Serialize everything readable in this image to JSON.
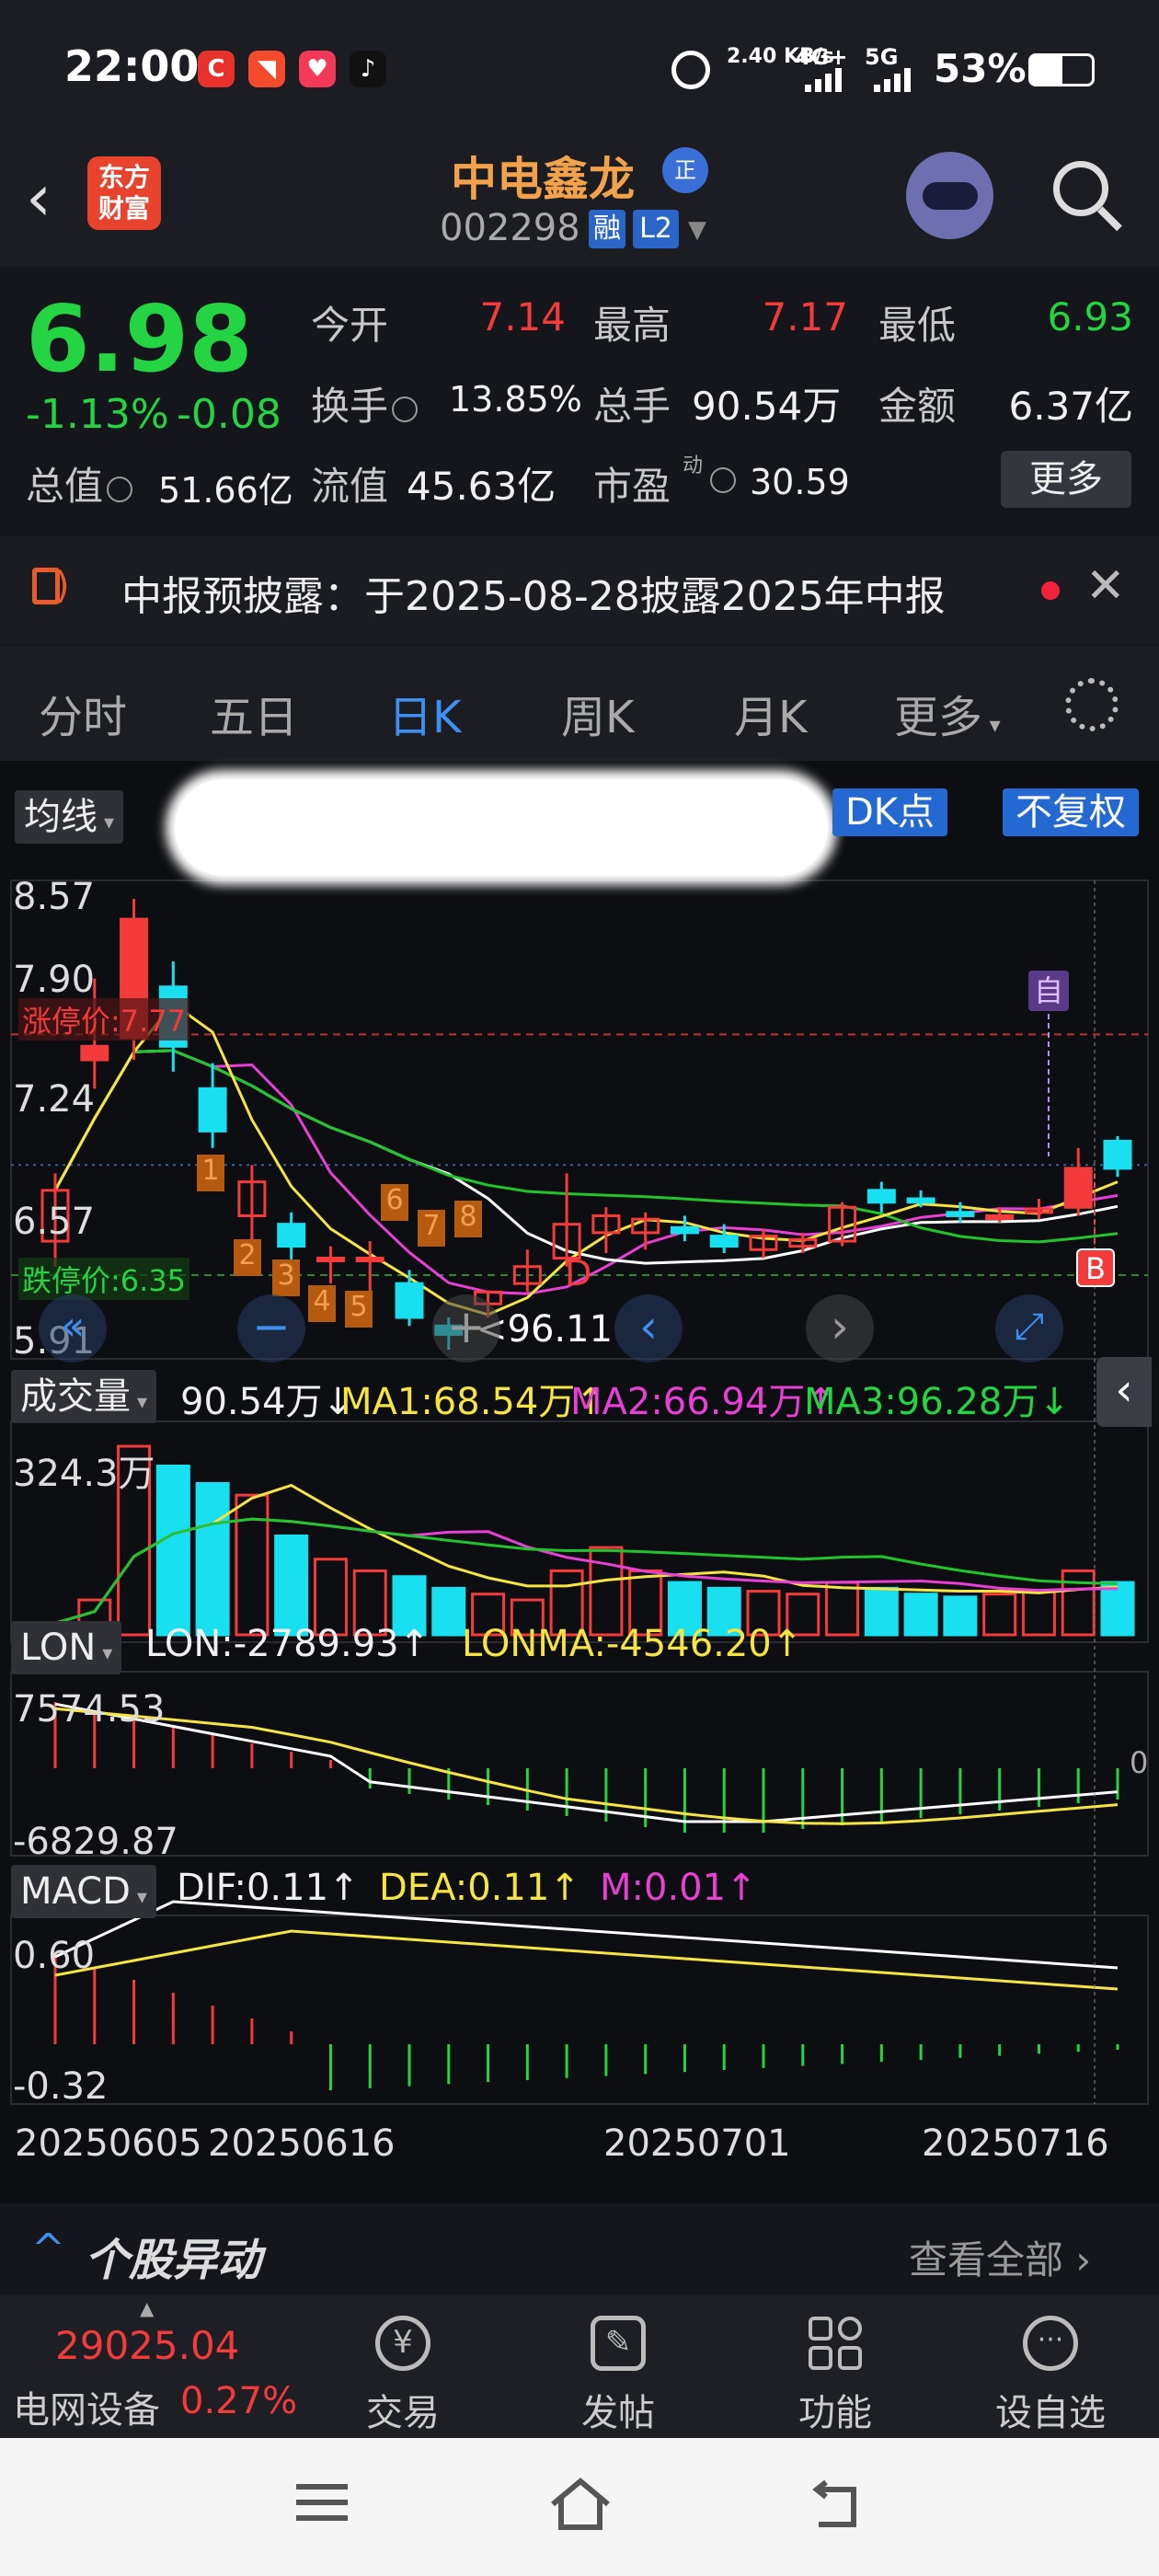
{
  "status_bar": {
    "time": "22:00",
    "network_speed": "2.40 KB/s",
    "signal1": "4G+",
    "signal2": "5G",
    "battery": "53%"
  },
  "header": {
    "logo_text": "东方\n财富",
    "stock_name": "中电鑫龙",
    "zheng_badge": "正",
    "stock_code": "002298",
    "rong_badge": "融",
    "l2_badge": "L2"
  },
  "quote": {
    "price": "6.98",
    "change_pct": "-1.13%",
    "change": "-0.08",
    "open_label": "今开",
    "open": "7.14",
    "high_label": "最高",
    "high": "7.17",
    "low_label": "最低",
    "low": "6.93",
    "turnover_label": "换手",
    "turnover": "13.85%",
    "volume_label": "总手",
    "volume": "90.54万",
    "amount_label": "金额",
    "amount": "6.37亿",
    "mktcap_label": "总值",
    "mktcap": "51.66亿",
    "float_label": "流值",
    "float": "45.63亿",
    "pe_label": "市盈",
    "pe_sup": "动",
    "pe": "30.59",
    "more_label": "更多"
  },
  "notice": {
    "text": "中报预披露：于2025-08-28披露2025年中报"
  },
  "tabs": [
    "分时",
    "五日",
    "日K",
    "周K",
    "月K",
    "更多"
  ],
  "active_tab": "日K",
  "chart_toolbar": {
    "ma_button": "均线",
    "dk_button": "DK点",
    "fq_button": "不复权"
  },
  "colors": {
    "up": "#f33b3b",
    "down": "#24d442",
    "accent": "#3e8ff2",
    "cyan_candle": "#19e0f0",
    "ma_white": "#ffffff",
    "ma_yellow": "#f5e442",
    "ma_magenta": "#e83fd4",
    "ma_green": "#22c42e"
  },
  "chart_data": [
    {
      "type": "candlestick",
      "y_ticks": [
        "8.57",
        "7.90",
        "7.24",
        "6.57",
        "5.91"
      ],
      "ylim": [
        5.91,
        8.57
      ],
      "limit_up_label": "涨停价:7.77",
      "limit_down_label": "跌停价:6.35",
      "low_marker": "96.11",
      "markers": {
        "self_select": "自",
        "buy": "B",
        "d": "D"
      },
      "number_labels": [
        "1",
        "2",
        "3",
        "4",
        "5",
        "6",
        "7",
        "8"
      ],
      "candles": [
        {
          "o": 6.55,
          "h": 6.95,
          "l": 6.4,
          "c": 6.85
        },
        {
          "o": 7.62,
          "h": 8.1,
          "l": 7.45,
          "c": 7.7
        },
        {
          "o": 7.75,
          "h": 8.57,
          "l": 7.62,
          "c": 8.45
        },
        {
          "o": 8.05,
          "h": 8.2,
          "l": 7.55,
          "c": 7.7
        },
        {
          "o": 7.45,
          "h": 7.6,
          "l": 7.1,
          "c": 7.2
        },
        {
          "o": 6.7,
          "h": 7.0,
          "l": 6.55,
          "c": 6.9
        },
        {
          "o": 6.65,
          "h": 6.72,
          "l": 6.4,
          "c": 6.52
        },
        {
          "o": 6.45,
          "h": 6.52,
          "l": 6.3,
          "c": 6.45
        },
        {
          "o": 6.45,
          "h": 6.55,
          "l": 6.25,
          "c": 6.45
        },
        {
          "o": 6.3,
          "h": 6.38,
          "l": 6.05,
          "c": 6.1
        },
        {
          "o": 6.05,
          "h": 6.1,
          "l": 5.91,
          "c": 6.0
        },
        {
          "o": 6.18,
          "h": 6.26,
          "l": 6.1,
          "c": 6.25
        },
        {
          "o": 6.3,
          "h": 6.5,
          "l": 6.25,
          "c": 6.4
        },
        {
          "o": 6.45,
          "h": 6.95,
          "l": 6.4,
          "c": 6.65
        },
        {
          "o": 6.6,
          "h": 6.75,
          "l": 6.48,
          "c": 6.7
        },
        {
          "o": 6.6,
          "h": 6.72,
          "l": 6.5,
          "c": 6.68
        },
        {
          "o": 6.63,
          "h": 6.7,
          "l": 6.55,
          "c": 6.6
        },
        {
          "o": 6.58,
          "h": 6.65,
          "l": 6.48,
          "c": 6.52
        },
        {
          "o": 6.5,
          "h": 6.62,
          "l": 6.45,
          "c": 6.58
        },
        {
          "o": 6.52,
          "h": 6.6,
          "l": 6.48,
          "c": 6.56
        },
        {
          "o": 6.55,
          "h": 6.78,
          "l": 6.52,
          "c": 6.75
        },
        {
          "o": 6.85,
          "h": 6.9,
          "l": 6.72,
          "c": 6.78
        },
        {
          "o": 6.8,
          "h": 6.85,
          "l": 6.75,
          "c": 6.78
        },
        {
          "o": 6.72,
          "h": 6.78,
          "l": 6.66,
          "c": 6.7
        },
        {
          "o": 6.7,
          "h": 6.75,
          "l": 6.66,
          "c": 6.7
        },
        {
          "o": 6.72,
          "h": 6.8,
          "l": 6.68,
          "c": 6.74
        },
        {
          "o": 6.75,
          "h": 7.1,
          "l": 6.7,
          "c": 6.98
        },
        {
          "o": 7.14,
          "h": 7.17,
          "l": 6.93,
          "c": 6.98
        }
      ]
    },
    {
      "type": "bar",
      "title": "成交量",
      "value": "90.54万",
      "ma1_label": "MA1:68.54万",
      "ma2_label": "MA2:66.94万",
      "ma3_label": "MA3:96.28万",
      "y_top": "324.3万",
      "values": [
        20,
        60,
        324,
        290,
        260,
        240,
        170,
        130,
        110,
        100,
        80,
        70,
        60,
        110,
        150,
        110,
        90,
        80,
        75,
        70,
        90,
        80,
        70,
        65,
        70,
        75,
        110,
        90
      ]
    },
    {
      "type": "line",
      "title": "LON",
      "lon_label": "LON:-2789.93",
      "lonma_label": "LONMA:-4546.20",
      "y_top": "7574.53",
      "y_bottom": "-6829.87",
      "zero_label": "0"
    },
    {
      "type": "line",
      "title": "MACD",
      "dif_label": "DIF:0.11",
      "dea_label": "DEA:0.11",
      "m_label": "M:0.01",
      "y_top": "0.60",
      "y_bottom": "-0.32"
    }
  ],
  "x_dates": [
    "20250605",
    "20250616",
    "20250701",
    "20250716"
  ],
  "movers": {
    "title": "个股异动",
    "view_all": "查看全部"
  },
  "bottom_bar": {
    "index_value": "29025.04",
    "index_name": "电网设备",
    "index_pct": "0.27%",
    "trade": "交易",
    "post": "发帖",
    "func": "功能",
    "watchlist": "设自选"
  }
}
